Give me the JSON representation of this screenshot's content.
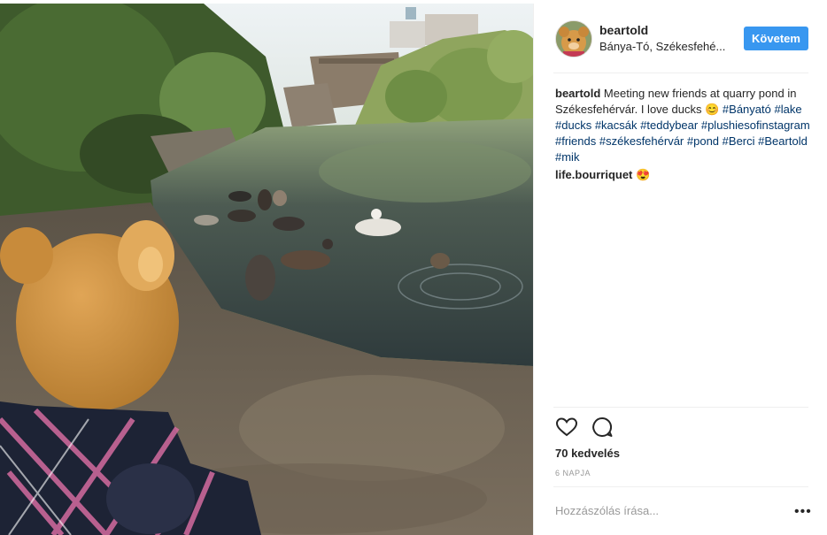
{
  "post": {
    "username": "beartold",
    "location": "Bánya-Tó, Székesfehé...",
    "follow_label": "Követem",
    "caption_user": "beartold",
    "caption_text": "Meeting new friends at quarry pond in Székesfehérvár. I love ducks",
    "caption_emoji": "😊",
    "hashtags": [
      "#Bányató",
      "#lake",
      "#ducks",
      "#kacsák",
      "#teddybear",
      "#plushiesofinstagram",
      "#friends",
      "#székesfehérvár",
      "#pond",
      "#Berci",
      "#Beartold",
      "#mik"
    ],
    "comment_user": "life.bourriquet",
    "comment_emoji": "😍",
    "likes": "70 kedvelés",
    "time": "6 NAPJA",
    "add_comment_placeholder": "Hozzászólás írása...",
    "more_label": "•••"
  },
  "icons": {
    "like": "heart-icon",
    "comment": "comment-icon"
  }
}
